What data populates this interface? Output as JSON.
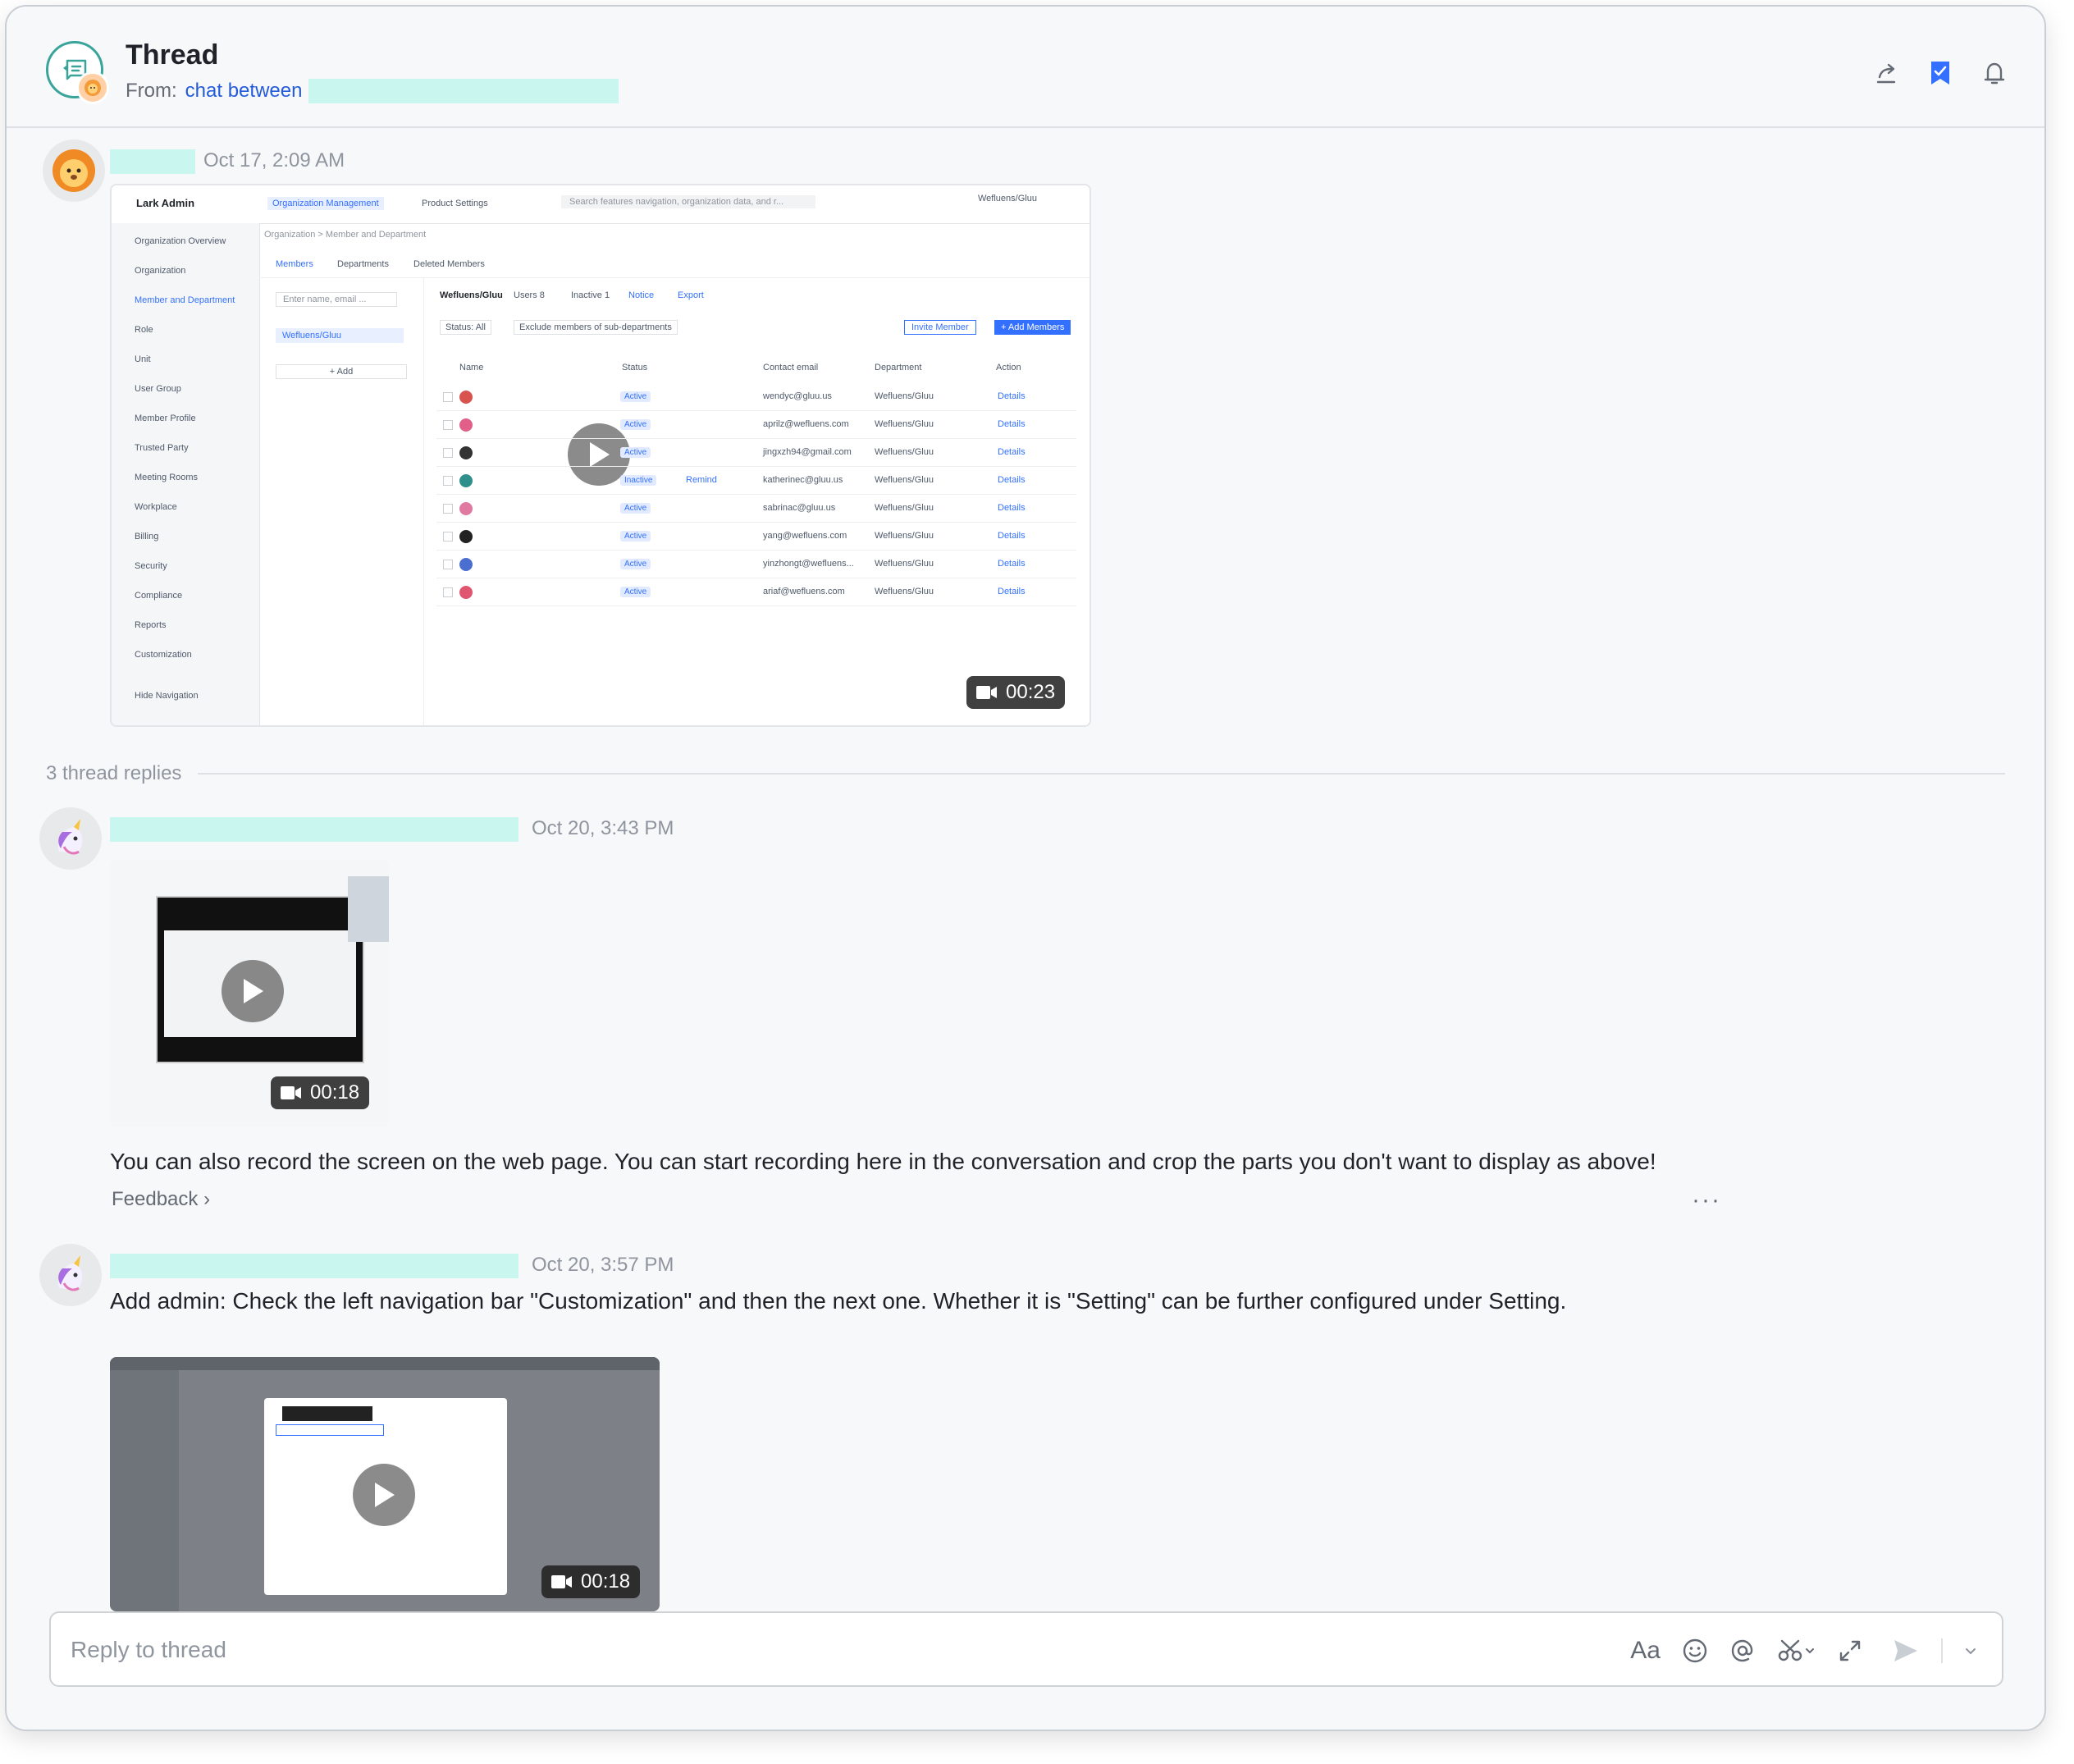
{
  "header": {
    "title": "Thread",
    "from_label": "From:",
    "from_link": "chat between",
    "actions": [
      "share-icon",
      "bookmark-icon",
      "bell-icon"
    ]
  },
  "root_message": {
    "timestamp": "Oct 17, 2:09 AM",
    "video": {
      "duration": "00:23",
      "preview": {
        "app_name": "Lark Admin",
        "top_tabs": [
          "Organization Management",
          "Product Settings"
        ],
        "search_placeholder": "Search features navigation, organization data, and r...",
        "account": "Wefluens/Gluu",
        "breadcrumb": "Organization  >  Member and Department",
        "sub_tabs": [
          "Members",
          "Departments",
          "Deleted Members"
        ],
        "sidebar": [
          "Organization Overview",
          "Organization",
          "Member and Department",
          "Role",
          "Unit",
          "User Group",
          "Member Profile",
          "Trusted Party",
          "Meeting Rooms",
          "Workplace",
          "Billing",
          "Security",
          "Compliance",
          "Reports",
          "Customization",
          "Hide Navigation"
        ],
        "org_name": "Wefluens/Gluu",
        "users_label": "Users  8",
        "inactive_label": "Inactive  1",
        "notice": "Notice",
        "export": "Export",
        "filter_status": "Status:  All",
        "filter_exclude": "Exclude members of sub-departments",
        "invite": "Invite Member",
        "add_members": "+ Add Members",
        "add": "+ Add",
        "search_member": "Enter name, email ...",
        "columns": [
          "Name",
          "Status",
          "Contact email",
          "Department",
          "Action"
        ],
        "rows": [
          {
            "status": "Active",
            "email": "wendyc@gluu.us",
            "dept": "Wefluens/Gluu",
            "action": "Details",
            "color": "#d9534f"
          },
          {
            "status": "Active",
            "email": "aprilz@wefluens.com",
            "dept": "Wefluens/Gluu",
            "action": "Details",
            "color": "#e0608a"
          },
          {
            "status": "Active",
            "email": "jingxzh94@gmail.com",
            "dept": "Wefluens/Gluu",
            "action": "Details",
            "color": "#333333"
          },
          {
            "status": "Inactive",
            "email": "katherinec@gluu.us",
            "dept": "Wefluens/Gluu",
            "action": "Details",
            "color": "#2f8f8a",
            "remind": "Remind"
          },
          {
            "status": "Active",
            "email": "sabrinac@gluu.us",
            "dept": "Wefluens/Gluu",
            "action": "Details",
            "color": "#e07aa0"
          },
          {
            "status": "Active",
            "email": "yang@wefluens.com",
            "dept": "Wefluens/Gluu",
            "action": "Details",
            "color": "#222222"
          },
          {
            "status": "Active",
            "email": "yinzhongt@wefluens...",
            "dept": "Wefluens/Gluu",
            "action": "Details",
            "color": "#4a6fd1"
          },
          {
            "status": "Active",
            "email": "ariaf@wefluens.com",
            "dept": "Wefluens/Gluu",
            "action": "Details",
            "color": "#e05570"
          }
        ]
      }
    }
  },
  "replies_label": "3 thread replies",
  "replies": [
    {
      "timestamp": "Oct 20, 3:43 PM",
      "video_duration": "00:18",
      "text": "You can also record the screen on the web page. You can start recording here in the conversation and crop the parts you don't want to display as above!",
      "feedback": "Feedback",
      "more": "···"
    },
    {
      "timestamp": "Oct 20, 3:57 PM",
      "text": "Add admin: Check the left navigation bar \"Customization\" and then the next one. Whether it is \"Setting\" can be further configured under Setting.",
      "video_duration": "00:18"
    }
  ],
  "composer": {
    "placeholder": "Reply to thread",
    "tools": [
      "font-icon",
      "emoji-icon",
      "mention-icon",
      "scissors-icon",
      "expand-icon",
      "send-icon"
    ],
    "font_label": "Aa"
  },
  "colors": {
    "accent": "#245bdb",
    "redaction": "#c9f7ef",
    "thread_ring": "#3aa49b"
  }
}
